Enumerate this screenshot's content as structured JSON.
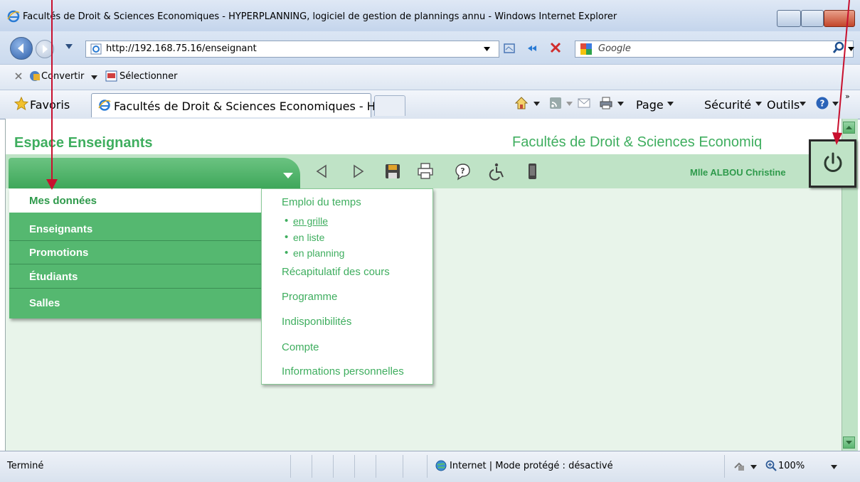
{
  "window": {
    "title": "Facultés de Droit & Sciences Economiques - HYPERPLANNING, logiciel de gestion de plannings annu - Windows Internet Explorer"
  },
  "address_bar": {
    "url_prefix": "http://",
    "url_host": "192.168.75.16",
    "url_path": "/enseignant",
    "search_placeholder": "Google"
  },
  "command_bar": {
    "convert_label": "Convertir",
    "select_label": "Sélectionner"
  },
  "favorites_bar": {
    "favorites_label": "Favoris",
    "tab_title": "Facultés de Droit & Sciences Economiques - HYP...",
    "page_label": "Page",
    "security_label": "Sécurité",
    "tools_label": "Outils"
  },
  "app": {
    "space_title": "Espace Enseignants",
    "institution": "Facultés de Droit & Sciences Economiq",
    "user_name": "Mlle ALBOU Christine"
  },
  "menu": {
    "items": [
      {
        "label": "Mes données"
      },
      {
        "label": "Enseignants"
      },
      {
        "label": "Promotions"
      },
      {
        "label": "Étudiants"
      },
      {
        "label": "Salles"
      }
    ],
    "active_index": 0
  },
  "submenu": {
    "sections": [
      {
        "label": "Emploi du temps",
        "children": [
          "en grille",
          "en liste",
          "en planning"
        ]
      },
      {
        "label": "Récapitulatif des cours"
      },
      {
        "label": "Programme"
      },
      {
        "label": "Indisponibilités"
      },
      {
        "label": "Compte"
      },
      {
        "label": "Informations personnelles"
      }
    ]
  },
  "status_bar": {
    "status": "Terminé",
    "zone": "Internet | Mode protégé : désactivé",
    "zoom": "100%"
  },
  "colors": {
    "brand_green": "#3fae5f",
    "menu_green": "#55b870",
    "annotation_red": "#c8102e"
  },
  "icons": [
    "ie-logo-icon",
    "back-icon",
    "forward-icon",
    "refresh-icon",
    "stop-icon",
    "search-icon",
    "star-icon",
    "home-icon",
    "rss-icon",
    "mail-icon",
    "print-icon",
    "help-icon",
    "triangle-left-icon",
    "triangle-right-icon",
    "save-icon",
    "printer-icon",
    "question-bubble-icon",
    "accessibility-icon",
    "mobile-icon",
    "power-icon",
    "globe-icon",
    "dropdown-arrow-icon"
  ]
}
